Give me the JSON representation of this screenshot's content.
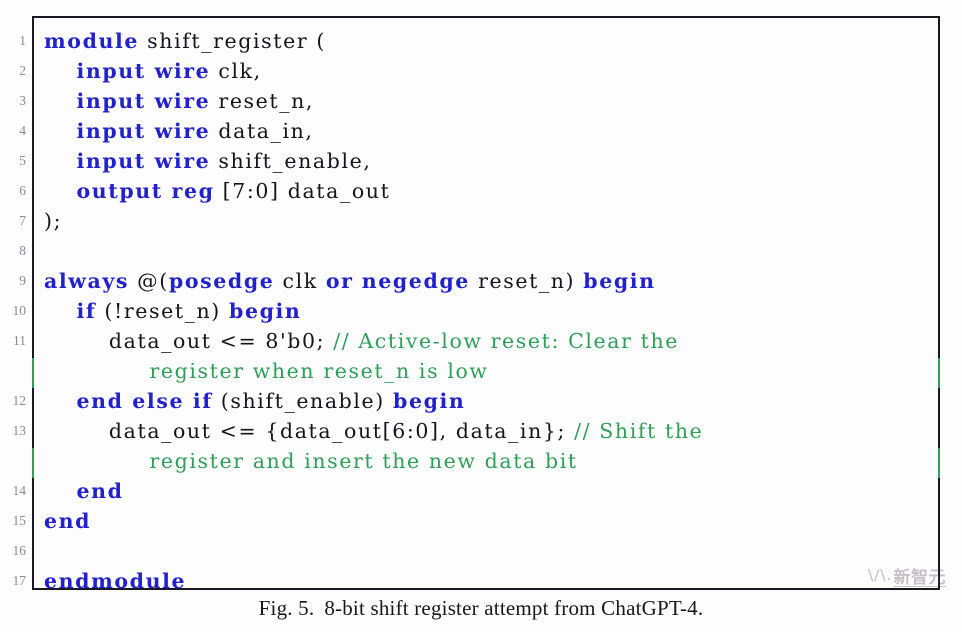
{
  "figure": {
    "caption_number": "Fig. 5.",
    "caption_text": "8-bit shift register attempt from ChatGPT-4.",
    "watermark_mark": "\\/\\.",
    "watermark_text": "新智元",
    "border_color": "#191724",
    "background_color": "#fdfdfd"
  },
  "code": {
    "language": "verilog",
    "keyword_color": "#2222cc",
    "comment_color": "#2f9e56",
    "plain_color": "#14141e",
    "line_number_color": "#8a8a96",
    "lines": [
      {
        "number": "1",
        "indent": 0,
        "tokens": [
          {
            "t": "kw",
            "s": "module"
          },
          {
            "t": "pln",
            "s": " shift_register ("
          }
        ]
      },
      {
        "number": "2",
        "indent": 0,
        "tokens": [
          {
            "t": "pln",
            "s": "    "
          },
          {
            "t": "kw",
            "s": "input wire"
          },
          {
            "t": "pln",
            "s": " clk,"
          }
        ]
      },
      {
        "number": "3",
        "indent": 0,
        "tokens": [
          {
            "t": "pln",
            "s": "    "
          },
          {
            "t": "kw",
            "s": "input wire"
          },
          {
            "t": "pln",
            "s": " reset_n,"
          }
        ]
      },
      {
        "number": "4",
        "indent": 0,
        "tokens": [
          {
            "t": "pln",
            "s": "    "
          },
          {
            "t": "kw",
            "s": "input wire"
          },
          {
            "t": "pln",
            "s": " data_in,"
          }
        ]
      },
      {
        "number": "5",
        "indent": 0,
        "tokens": [
          {
            "t": "pln",
            "s": "    "
          },
          {
            "t": "kw",
            "s": "input wire"
          },
          {
            "t": "pln",
            "s": " shift_enable,"
          }
        ]
      },
      {
        "number": "6",
        "indent": 0,
        "tokens": [
          {
            "t": "pln",
            "s": "    "
          },
          {
            "t": "kw",
            "s": "output reg"
          },
          {
            "t": "pln",
            "s": " [7:0] data_out"
          }
        ]
      },
      {
        "number": "7",
        "indent": 0,
        "tokens": [
          {
            "t": "pln",
            "s": ");"
          }
        ]
      },
      {
        "number": "8",
        "indent": 0,
        "tokens": []
      },
      {
        "number": "9",
        "indent": 0,
        "tokens": [
          {
            "t": "kw",
            "s": "always"
          },
          {
            "t": "pln",
            "s": " @("
          },
          {
            "t": "kw",
            "s": "posedge"
          },
          {
            "t": "pln",
            "s": " clk "
          },
          {
            "t": "kw",
            "s": "or"
          },
          {
            "t": "pln",
            "s": " "
          },
          {
            "t": "kw",
            "s": "negedge"
          },
          {
            "t": "pln",
            "s": " reset_n) "
          },
          {
            "t": "kw",
            "s": "begin"
          }
        ]
      },
      {
        "number": "10",
        "indent": 0,
        "tokens": [
          {
            "t": "pln",
            "s": "    "
          },
          {
            "t": "kw",
            "s": "if"
          },
          {
            "t": "pln",
            "s": " (!reset_n) "
          },
          {
            "t": "kw",
            "s": "begin"
          }
        ]
      },
      {
        "number": "11",
        "indent": 0,
        "tokens": [
          {
            "t": "pln",
            "s": "        data_out <= 8'b0; "
          },
          {
            "t": "cmt",
            "s": "// Active-low reset: Clear the"
          }
        ]
      },
      {
        "number": "",
        "indent": 0,
        "tokens": [
          {
            "t": "pln",
            "s": "             "
          },
          {
            "t": "cmt",
            "s": "register when reset_n is low"
          }
        ]
      },
      {
        "number": "12",
        "indent": 0,
        "tokens": [
          {
            "t": "pln",
            "s": "    "
          },
          {
            "t": "kw",
            "s": "end else if"
          },
          {
            "t": "pln",
            "s": " (shift_enable) "
          },
          {
            "t": "kw",
            "s": "begin"
          }
        ]
      },
      {
        "number": "13",
        "indent": 0,
        "tokens": [
          {
            "t": "pln",
            "s": "        data_out <= {data_out[6:0], data_in}; "
          },
          {
            "t": "cmt",
            "s": "// Shift the"
          }
        ]
      },
      {
        "number": "",
        "indent": 0,
        "tokens": [
          {
            "t": "pln",
            "s": "             "
          },
          {
            "t": "cmt",
            "s": "register and insert the new data bit"
          }
        ]
      },
      {
        "number": "14",
        "indent": 0,
        "tokens": [
          {
            "t": "pln",
            "s": "    "
          },
          {
            "t": "kw",
            "s": "end"
          }
        ]
      },
      {
        "number": "15",
        "indent": 0,
        "tokens": [
          {
            "t": "kw",
            "s": "end"
          }
        ]
      },
      {
        "number": "16",
        "indent": 0,
        "tokens": []
      },
      {
        "number": "17",
        "indent": 0,
        "tokens": [
          {
            "t": "kw",
            "s": "endmodule"
          }
        ]
      }
    ]
  }
}
